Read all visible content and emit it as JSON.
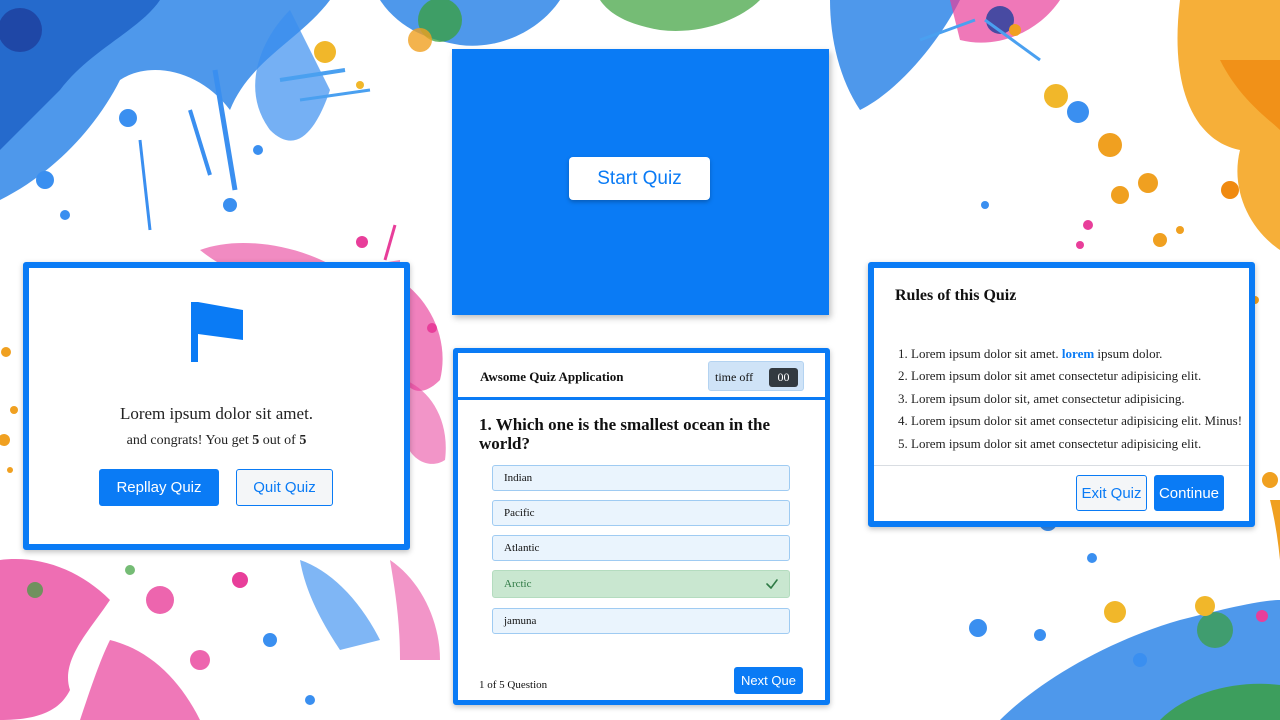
{
  "colors": {
    "accent": "#0a7bf5",
    "correct_bg": "#c9e7d0",
    "correct_text": "#2f7a45",
    "option_bg": "#eaf4fd",
    "timer_bg": "#cfe3f7",
    "timer_sec_bg": "#333a40"
  },
  "start": {
    "button_label": "Start Quiz"
  },
  "result": {
    "icon": "flag-icon",
    "line1": "Lorem ipsum dolor sit amet.",
    "line2_prefix": "and congrats! You get",
    "score": "5",
    "line2_middle": "out of",
    "total": "5",
    "replay_label": "Repllay Quiz",
    "quit_label": "Quit Quiz"
  },
  "quiz": {
    "title": "Awsome Quiz Application",
    "timer_label": "time off",
    "timer_value": "00",
    "question": "1. Which one is the smallest ocean in the world?",
    "options": [
      {
        "label": "Indian",
        "state": "normal"
      },
      {
        "label": "Pacific",
        "state": "normal"
      },
      {
        "label": "Atlantic",
        "state": "normal"
      },
      {
        "label": "Arctic",
        "state": "correct",
        "icon": "check-icon"
      },
      {
        "label": "jamuna",
        "state": "normal"
      }
    ],
    "question_count": "1 of 5 Question",
    "next_label": "Next Que"
  },
  "rules": {
    "title": "Rules of this Quiz",
    "items": [
      {
        "prefix": "1. Lorem ipsum dolor sit amet. ",
        "accent": "lorem",
        "suffix": " ipsum dolor."
      },
      {
        "text": "2. Lorem ipsum dolor sit amet consectetur adipisicing elit."
      },
      {
        "text": "3. Lorem ipsum dolor sit, amet consectetur adipisicing."
      },
      {
        "text": "4. Lorem ipsum dolor sit amet consectetur adipisicing elit. Minus!"
      },
      {
        "text": "5. Lorem ipsum dolor sit amet consectetur adipisicing elit."
      }
    ],
    "exit_label": "Exit Quiz",
    "continue_label": "Continue"
  }
}
